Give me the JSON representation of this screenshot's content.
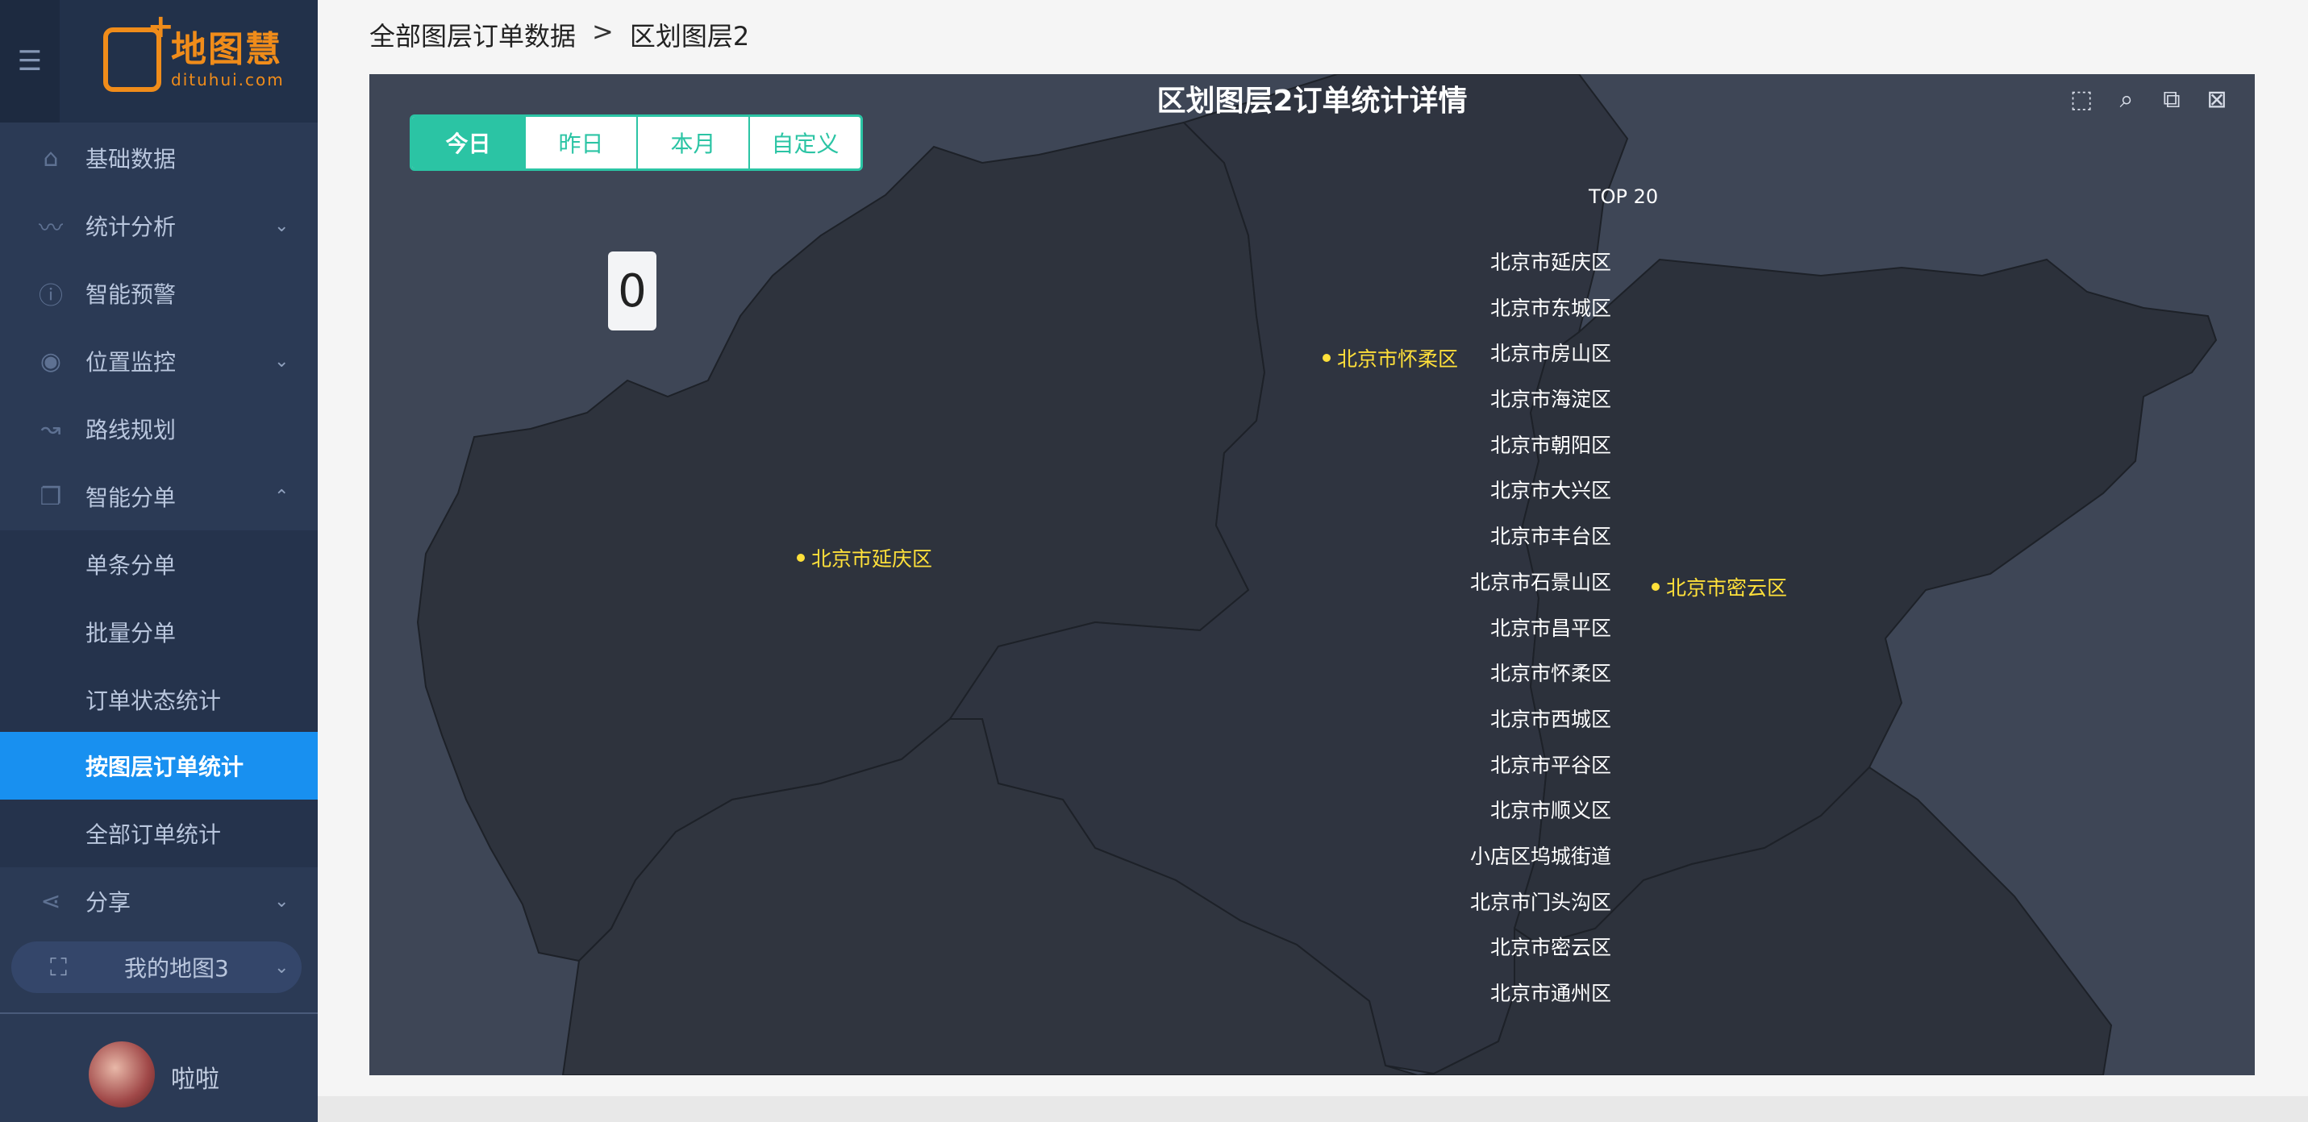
{
  "sidebar": {
    "logo_title": "地图慧",
    "logo_url": "dituhui.com",
    "items": [
      {
        "label": "基础数据",
        "icon": "home-icon"
      },
      {
        "label": "统计分析",
        "icon": "chart-line-icon"
      },
      {
        "label": "智能预警",
        "icon": "info-icon"
      },
      {
        "label": "位置监控",
        "icon": "location-pin-icon"
      },
      {
        "label": "路线规划",
        "icon": "route-icon"
      },
      {
        "label": "智能分单",
        "icon": "copy-icon"
      },
      {
        "label": "分享",
        "icon": "share-icon"
      }
    ],
    "sub_items": [
      {
        "label": "单条分单"
      },
      {
        "label": "批量分单"
      },
      {
        "label": "订单状态统计"
      },
      {
        "label": "按图层订单统计"
      },
      {
        "label": "全部订单统计"
      }
    ],
    "my_map": "我的地图3",
    "user_name": "啦啦"
  },
  "breadcrumb": {
    "parent": "全部图层订单数据",
    "separator": ">",
    "current": "区划图层2"
  },
  "chart": {
    "title": "区划图层2订单统计详情",
    "tabs": [
      "今日",
      "昨日",
      "本月",
      "自定义"
    ],
    "active_tab": "今日",
    "counter": "0",
    "top_title": "TOP 20"
  },
  "chart_data": {
    "type": "table",
    "title": "区划图层2订单统计详情",
    "total": 0,
    "top_list": [
      "北京市延庆区",
      "北京市东城区",
      "北京市房山区",
      "北京市海淀区",
      "北京市朝阳区",
      "北京市大兴区",
      "北京市丰台区",
      "北京市石景山区",
      "北京市昌平区",
      "北京市怀柔区",
      "北京市西城区",
      "北京市平谷区",
      "北京市顺义区",
      "小店区坞城街道",
      "北京市门头沟区",
      "北京市密云区",
      "北京市通州区"
    ],
    "map_labels": [
      "北京市怀柔区",
      "北京市延庆区",
      "北京市密云区"
    ]
  },
  "colors": {
    "sidebar_bg": "#2b3a55",
    "active_nav": "#1890f0",
    "tab_accent": "#2bc4a4",
    "map_label": "#ffe03a",
    "map_bg": "#3e4656",
    "region_fill": "#2e333d",
    "logo_orange": "#f08c1a"
  },
  "toolbox_icons": [
    "zoom-select-icon",
    "lasso-select-icon",
    "rect-select-icon",
    "clear-select-icon"
  ]
}
